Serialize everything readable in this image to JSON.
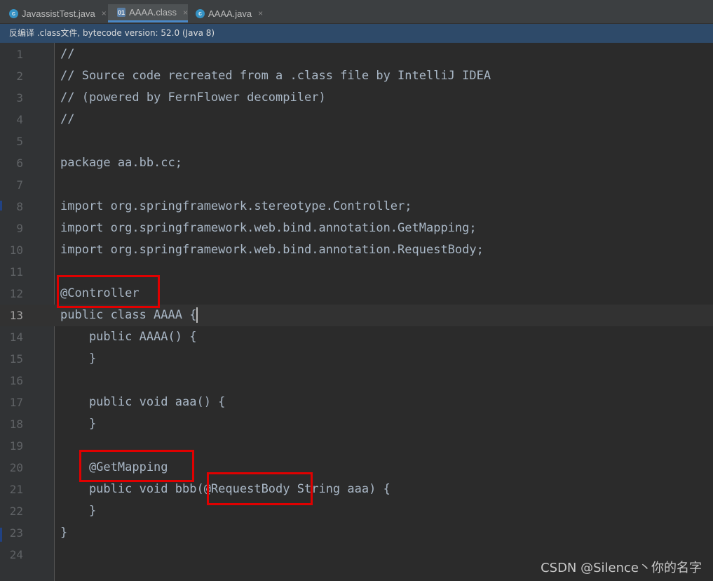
{
  "tabs": [
    {
      "label": "JavassistTest.java",
      "icon": "java-class-icon",
      "close": "×"
    },
    {
      "label": "AAAA.class",
      "icon": "class-file-icon",
      "close": "×",
      "active": true
    },
    {
      "label": "AAAA.java",
      "icon": "java-class-icon",
      "close": "×"
    }
  ],
  "notice": "反编译 .class文件, bytecode version: 52.0 (Java 8)",
  "lines": [
    {
      "num": "1",
      "text": "//"
    },
    {
      "num": "2",
      "text": "// Source code recreated from a .class file by IntelliJ IDEA"
    },
    {
      "num": "3",
      "text": "// (powered by FernFlower decompiler)"
    },
    {
      "num": "4",
      "text": "//"
    },
    {
      "num": "5",
      "text": ""
    },
    {
      "num": "6",
      "text": "package aa.bb.cc;"
    },
    {
      "num": "7",
      "text": ""
    },
    {
      "num": "8",
      "text": "import org.springframework.stereotype.Controller;"
    },
    {
      "num": "9",
      "text": "import org.springframework.web.bind.annotation.GetMapping;"
    },
    {
      "num": "10",
      "text": "import org.springframework.web.bind.annotation.RequestBody;"
    },
    {
      "num": "11",
      "text": ""
    },
    {
      "num": "12",
      "text": "@Controller"
    },
    {
      "num": "13",
      "text": "public class AAAA {"
    },
    {
      "num": "14",
      "text": "    public AAAA() {"
    },
    {
      "num": "15",
      "text": "    }"
    },
    {
      "num": "16",
      "text": ""
    },
    {
      "num": "17",
      "text": "    public void aaa() {"
    },
    {
      "num": "18",
      "text": "    }"
    },
    {
      "num": "19",
      "text": ""
    },
    {
      "num": "20",
      "text": "    @GetMapping"
    },
    {
      "num": "21",
      "text": "    public void bbb(@RequestBody String aaa) {"
    },
    {
      "num": "22",
      "text": "    }"
    },
    {
      "num": "23",
      "text": "}"
    },
    {
      "num": "24",
      "text": ""
    }
  ],
  "current_line": 13,
  "watermark": "CSDN @Silence丶你的名字",
  "colors": {
    "highlight_box": "#e00000",
    "tab_active_underline": "#4a88c7",
    "notice_bg": "#2e4a69"
  }
}
